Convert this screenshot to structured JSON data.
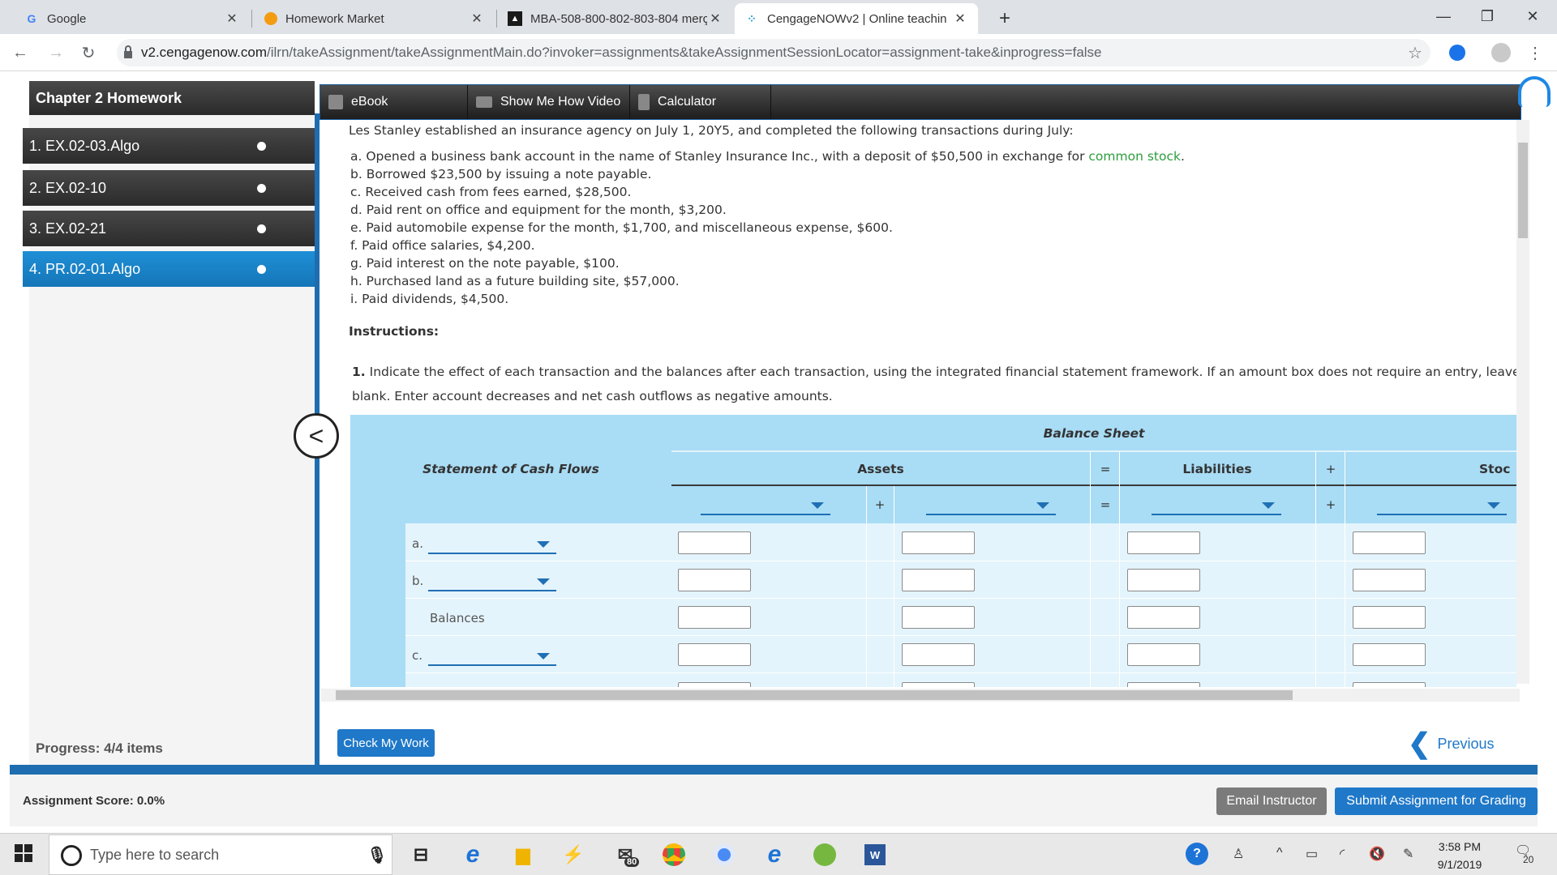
{
  "browser": {
    "tabs": [
      {
        "title": "Google",
        "icon": "G"
      },
      {
        "title": "Homework Market",
        "icon": "homework-market-icon"
      },
      {
        "title": "MBA-508-800-802-803-804 merç",
        "icon": "mba-icon"
      },
      {
        "title": "CengageNOWv2 | Online teachin",
        "icon": "cengage-icon"
      }
    ],
    "new_tab": "+",
    "url_host": "v2.cengagenow.com",
    "url_path": "/ilrn/takeAssignment/takeAssignmentMain.do?invoker=assignments&takeAssignmentSessionLocator=assignment-take&inprogress=false"
  },
  "sidebar": {
    "title": "Chapter 2 Homework",
    "items": [
      {
        "label": "1. EX.02-03.Algo"
      },
      {
        "label": "2. EX.02-10"
      },
      {
        "label": "3. EX.02-21"
      },
      {
        "label": "4. PR.02-01.Algo"
      }
    ],
    "progress": "Progress:  4/4 items"
  },
  "toolbar": {
    "ebook": "eBook",
    "video": "Show Me How Video",
    "calculator": "Calculator"
  },
  "problem": {
    "intro": "Les Stanley established an insurance agency on July 1, 20Y5, and completed the following transactions during July:",
    "transactions": [
      "a. Opened a business bank account in the name of Stanley Insurance Inc., with a deposit of $50,500 in exchange for",
      "b. Borrowed $23,500 by issuing a note payable.",
      "c. Received cash from fees earned, $28,500.",
      "d. Paid rent on office and equipment for the month, $3,200.",
      "e. Paid automobile expense for the month, $1,700, and miscellaneous expense, $600.",
      "f. Paid office salaries, $4,200.",
      "g. Paid interest on the note payable, $100.",
      "h. Purchased land as a future building site, $57,000.",
      "i. Paid dividends, $4,500."
    ],
    "common_stock": "common stock",
    "period": ".",
    "instructions_heading": "Instructions:",
    "instruction_num": "1.",
    "instruction_line1": "Indicate the effect of each transaction and the balances after each transaction, using the integrated financial statement framework. If an amount box does not require an entry, leave it",
    "instruction_line2": "blank. Enter account decreases and net cash outflows as negative amounts."
  },
  "table": {
    "balance_sheet": "Balance Sheet",
    "cash_flows": "Statement of Cash Flows",
    "assets": "Assets",
    "liabilities": "Liabilities",
    "stockholders": "Stoc",
    "equals": "=",
    "plus": "+",
    "rows": [
      {
        "label": "a.",
        "type": "dropdown"
      },
      {
        "label": "b.",
        "type": "dropdown"
      },
      {
        "label": "Balances",
        "type": "text"
      },
      {
        "label": "c.",
        "type": "dropdown"
      }
    ]
  },
  "actions": {
    "check": "Check My Work",
    "previous": "Previous",
    "score": "Assignment Score: 0.0%",
    "email": "Email Instructor",
    "submit": "Submit Assignment for Grading"
  },
  "taskbar": {
    "search_placeholder": "Type here to search",
    "time": "3:58 PM",
    "date": "9/1/2019",
    "badge": "80",
    "notifications": "20"
  }
}
